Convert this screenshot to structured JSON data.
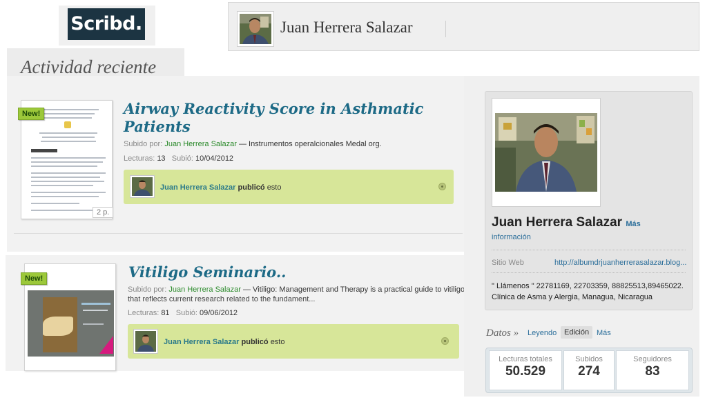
{
  "brand": {
    "logo_text": "Scribd."
  },
  "header": {
    "user_name": "Juan Herrera Salazar"
  },
  "section_title": "Actividad reciente",
  "feed": [
    {
      "badge": "New!",
      "title": "Airway Reactivity Score in Asthmatic Patients",
      "uploaded_by_label": "Subido por:",
      "uploader": "Juan Herrera Salazar",
      "uploader_suffix": "— Instrumentos operalcionales Medal org.",
      "description": "",
      "reads_label": "Lecturas:",
      "reads": "13",
      "date_label": "Subió:",
      "date": "10/04/2012",
      "pages": "2 p.",
      "published_by": "Juan Herrera Salazar",
      "published_verb": "publicó",
      "published_suffix": "esto"
    },
    {
      "badge": "New!",
      "title": "Vitiligo Seminario..",
      "uploaded_by_label": "Subido por:",
      "uploader": "Juan Herrera Salazar",
      "uploader_suffix": "— Vitiligo: Management and Therapy is a practical guide to vitiligo",
      "description": "that reflects current research related to the fundament...",
      "reads_label": "Lecturas:",
      "reads": "81",
      "date_label": "Subió:",
      "date": "09/06/2012",
      "published_by": "Juan Herrera Salazar",
      "published_verb": "publicó",
      "published_suffix": "esto"
    }
  ],
  "profile": {
    "name": "Juan Herrera Salazar",
    "more_info_1": "Más",
    "more_info_2": "información",
    "website_label": "Sitio Web",
    "website": "http://albumdrjuanherrerasalazar.blog...",
    "contact_line1": "\" Llámenos \" 22781169, 22703359, 88825513,89465022.",
    "contact_line2": "Clínica de Asma y Alergia, Managua, Nicaragua"
  },
  "stats_tabs": {
    "title": "Datos »",
    "reading": "Leyendo",
    "editing": "Edición",
    "more": "Más"
  },
  "stats": [
    {
      "label": "Lecturas totales",
      "value": "50.529"
    },
    {
      "label": "Subidos",
      "value": "274"
    },
    {
      "label": "Seguidores",
      "value": "83"
    }
  ],
  "colors": {
    "brand_dark": "#1c3442",
    "title_blue": "#1d6a86",
    "link_green": "#2b8a2b",
    "badge_green": "#9cc83a",
    "publish_bg": "#d7e699"
  }
}
